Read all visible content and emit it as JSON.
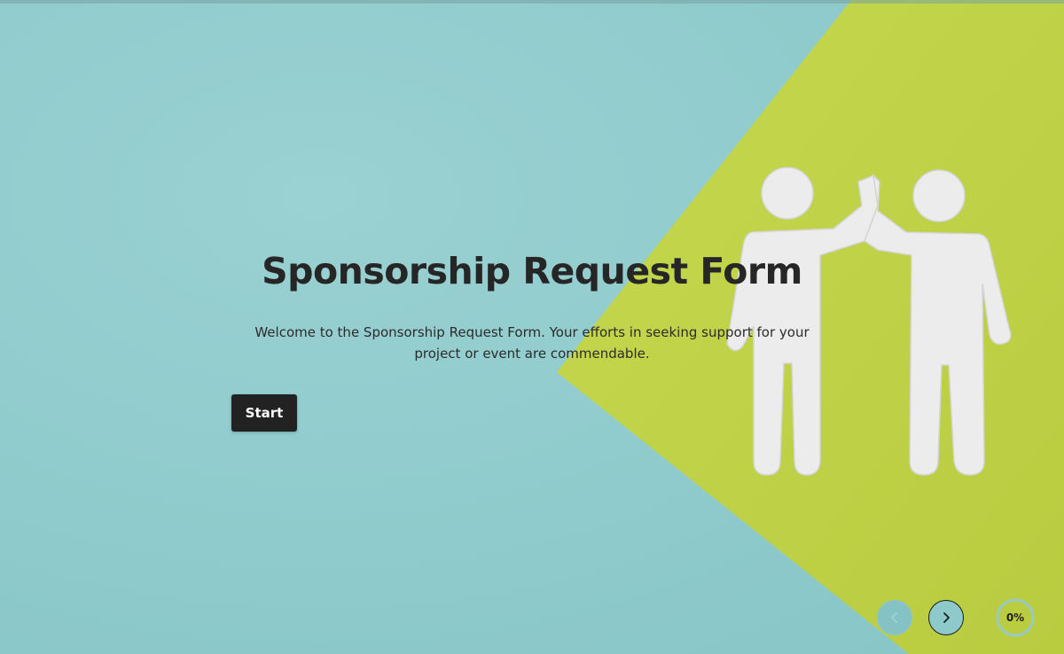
{
  "form": {
    "title": "Sponsorship Request Form",
    "description": "Welcome to the Sponsorship Request Form. Your efforts in seeking support for your project or event are commendable.",
    "start_label": "Start"
  },
  "navigation": {
    "prev_icon": "chevron-left-icon",
    "next_icon": "chevron-right-icon"
  },
  "progress": {
    "percent_label": "0%",
    "value": 0
  },
  "background": {
    "image": "high-five-figures-illustration",
    "colors": {
      "teal": "#91cccd",
      "lime": "#c3d44a",
      "figure": "#ececec"
    }
  },
  "colors": {
    "text": "#262626",
    "button": "#222222",
    "button_text": "#ffffff"
  }
}
